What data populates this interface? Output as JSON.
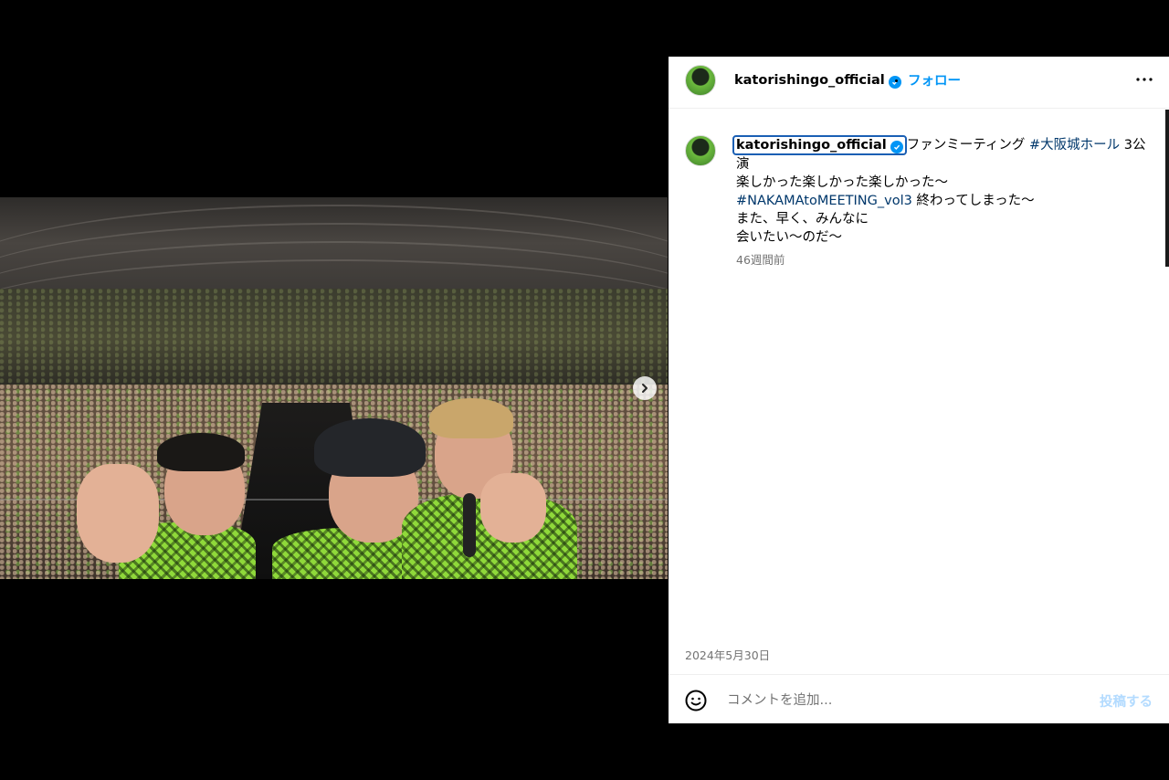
{
  "post": {
    "username": "katorishingo_official",
    "follow_label": "フォロー",
    "caption": {
      "line1_text": "ファンミーティング ",
      "hashtag1": "#大阪城ホール",
      "line1_tail": " 3公",
      "line2": "演",
      "line3": "楽しかった楽しかった楽しかった〜",
      "hashtag2": "#NAKAMAtoMEETING_vol3",
      "line4_tail": " 終わってしまった〜",
      "line5": "また、早く、みんなに",
      "line6": "会いたい〜のだ〜"
    },
    "time_ago": "46週間前",
    "date": "2024年5月30日"
  },
  "comment": {
    "placeholder": "コメントを追加...",
    "post_label": "投稿する"
  },
  "icons": {
    "verified": "verified-badge-icon",
    "more": "more-options-icon",
    "next": "chevron-right-icon",
    "emoji": "emoji-smiley-icon"
  },
  "colors": {
    "link_blue": "#0095f6",
    "hashtag": "#00376b",
    "muted": "#737373",
    "jacket_green": "#8fd93a"
  }
}
